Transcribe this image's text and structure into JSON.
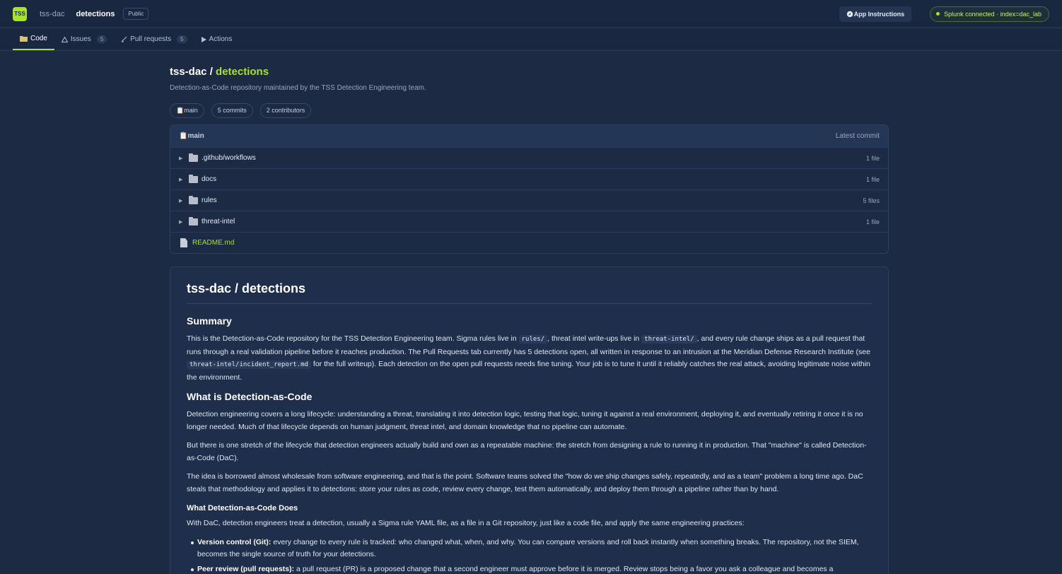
{
  "header": {
    "logo": "TSS",
    "org": "tss-dac",
    "repo": "detections",
    "visibility": "Public",
    "instructions_label": "App Instructions",
    "connection": "Splunk connected · index=dac_lab"
  },
  "tabs": [
    {
      "label": "Code",
      "icon": "folder-icon",
      "count": ""
    },
    {
      "label": "Issues",
      "icon": "warning-icon",
      "count": "5"
    },
    {
      "label": "Pull requests",
      "icon": "pull-request-icon",
      "count": "5"
    },
    {
      "label": "Actions",
      "icon": "play-icon",
      "count": ""
    }
  ],
  "repo": {
    "org": "tss-dac",
    "separator": " / ",
    "name": "detections",
    "description": "Detection-as-Code repository maintained by the TSS Detection Engineering team.",
    "branch_pill": "main",
    "commits_pill": "5 commits",
    "contributors_pill": "2 contributors"
  },
  "filebox": {
    "branch": "main",
    "latest": "Latest commit",
    "rows": [
      {
        "name": ".github/workflows",
        "meta": "1 file"
      },
      {
        "name": "docs",
        "meta": "1 file"
      },
      {
        "name": "rules",
        "meta": "5 files"
      },
      {
        "name": "threat-intel",
        "meta": "1 file"
      }
    ],
    "readme_file": "README.md"
  },
  "readme": {
    "h1": "tss-dac / detections",
    "summary_h": "Summary",
    "summary": {
      "t1": "This is the Detection-as-Code repository for the TSS Detection Engineering team. Sigma rules live in ",
      "c1": "rules/",
      "t2": ", threat intel write-ups live in ",
      "c2": "threat-intel/",
      "t3": ", and every rule change ships as a pull request that runs through a real validation pipeline before it reaches production. The Pull Requests tab currently has 5 detections open, all written in response to an intrusion at the Meridian Defense Research Institute (see ",
      "c3": "threat-intel/incident_report.md",
      "t4": " for the full writeup). Each detection on the open pull requests needs fine tuning. Your job is to tune it until it reliably catches the real attack, avoiding legitimate noise within the environment."
    },
    "what_h": "What is Detection-as-Code",
    "p1": "Detection engineering covers a long lifecycle: understanding a threat, translating it into detection logic, testing that logic, tuning it against a real environment, deploying it, and eventually retiring it once it is no longer needed. Much of that lifecycle depends on human judgment, threat intel, and domain knowledge that no pipeline can automate.",
    "p2": "But there is one stretch of the lifecycle that detection engineers actually build and own as a repeatable machine: the stretch from designing a rule to running it in production. That \"machine\" is called Detection-as-Code (DaC).",
    "p3": "The idea is borrowed almost wholesale from software engineering, and that is the point. Software teams solved the \"how do we ship changes safely, repeatedly, and as a team\" problem a long time ago. DaC steals that methodology and applies it to detections: store your rules as code, review every change, test them automatically, and deploy them through a pipeline rather than by hand.",
    "does_h": "What Detection-as-Code Does",
    "p4": "With DaC, detection engineers treat a detection, usually a Sigma rule YAML file, as a file in a Git repository, just like a code file, and apply the same engineering practices:",
    "bullets": [
      {
        "b": "Version control (Git):",
        "t": " every change to every rule is tracked: who changed what, when, and why. You can compare versions and roll back instantly when something breaks. The repository, not the SIEM, becomes the single source of truth for your detections."
      },
      {
        "b": "Peer review (pull requests):",
        "t": " a pull request (PR) is a proposed change that a second engineer must approve before it is merged. Review stops being a favor you ask a colleague and becomes a"
      }
    ]
  }
}
